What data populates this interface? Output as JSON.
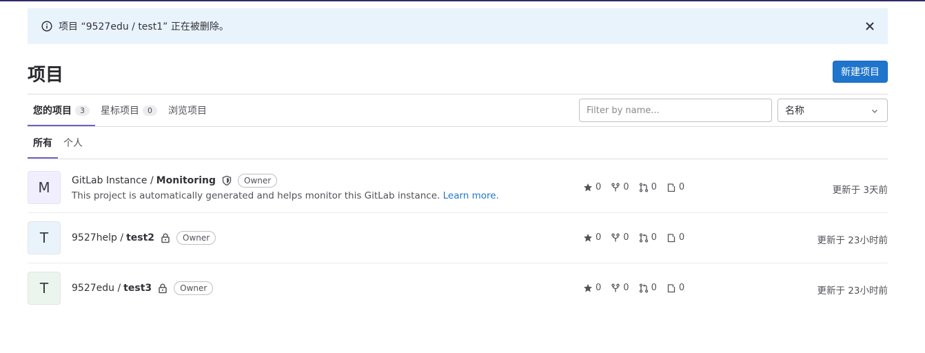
{
  "alert": {
    "message": "项目 “9527edu / test1” 正在被删除。",
    "icon": "info-icon",
    "close_icon": "close-icon"
  },
  "page": {
    "title": "项目",
    "new_project_label": "新建项目"
  },
  "tabs": [
    {
      "label": "您的项目",
      "count": "3"
    },
    {
      "label": "星标项目",
      "count": "0"
    },
    {
      "label": "浏览项目"
    }
  ],
  "filter": {
    "placeholder": "Filter by name..."
  },
  "sort": {
    "selected": "名称"
  },
  "subtabs": [
    {
      "label": "所有"
    },
    {
      "label": "个人"
    }
  ],
  "projects": [
    {
      "avatar": "M",
      "avatar_bg": "#f1efff",
      "namespace": "GitLab Instance /",
      "name": "Monitoring",
      "visibility_icon": "shield-icon",
      "role": "Owner",
      "description": "This project is automatically generated and helps monitor this GitLab instance.",
      "learn_more": "Learn more.",
      "stars": "0",
      "forks": "0",
      "merge_requests": "0",
      "issues": "0",
      "updated": "更新于 3天前"
    },
    {
      "avatar": "T",
      "avatar_bg": "#e9f3fc",
      "namespace": "9527help /",
      "name": "test2",
      "visibility_icon": "lock-icon",
      "role": "Owner",
      "stars": "0",
      "forks": "0",
      "merge_requests": "0",
      "issues": "0",
      "updated": "更新于 23小时前"
    },
    {
      "avatar": "T",
      "avatar_bg": "#ecf4ee",
      "namespace": "9527edu /",
      "name": "test3",
      "visibility_icon": "lock-icon",
      "role": "Owner",
      "stars": "0",
      "forks": "0",
      "merge_requests": "0",
      "issues": "0",
      "updated": "更新于 23小时前"
    }
  ],
  "colors": {
    "accent": "#1f75cb",
    "tab_indicator": "#6f60c4",
    "alert_bg": "#e9f3fc"
  }
}
